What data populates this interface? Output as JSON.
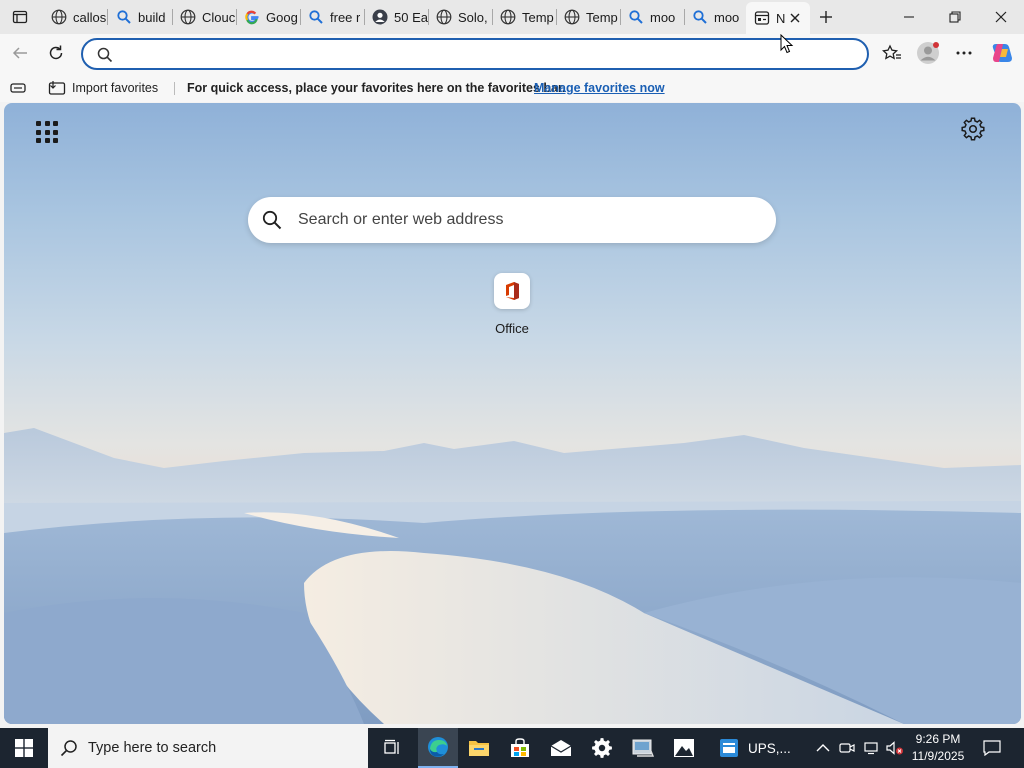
{
  "tabs": [
    {
      "label": "callos",
      "icon": "globe-icon"
    },
    {
      "label": "build",
      "icon": "search-icon"
    },
    {
      "label": "Clouc",
      "icon": "globe-icon"
    },
    {
      "label": "Goog",
      "icon": "google-icon"
    },
    {
      "label": "free r",
      "icon": "search-icon"
    },
    {
      "label": "50 Ea",
      "icon": "avatar-icon"
    },
    {
      "label": "Solo,",
      "icon": "globe-icon"
    },
    {
      "label": "Temp",
      "icon": "globe-icon"
    },
    {
      "label": "Temp",
      "icon": "globe-icon"
    },
    {
      "label": "moo",
      "icon": "search-icon"
    },
    {
      "label": "moo",
      "icon": "search-icon"
    },
    {
      "label": "N",
      "icon": "newtab-icon",
      "active": true
    }
  ],
  "address": {
    "value": "",
    "placeholder": ""
  },
  "favorites_bar": {
    "import_label": "Import favorites",
    "message": "For quick access, place your favorites here on the favorites bar.",
    "manage_link": "Manage favorites now"
  },
  "newtab": {
    "search_placeholder": "Search or enter web address",
    "quick_links": [
      {
        "label": "Office",
        "icon": "office-icon"
      }
    ]
  },
  "taskbar": {
    "search_placeholder": "Type here to search",
    "running_label": "UPS,...",
    "time": "9:26 PM",
    "date": "11/9/2025"
  },
  "colors": {
    "accent": "#1f5fb0",
    "link": "#1a5fb4",
    "taskbar": "#1c2530"
  }
}
